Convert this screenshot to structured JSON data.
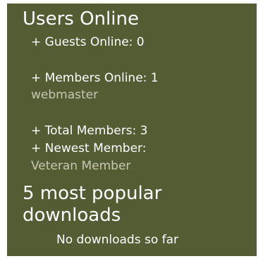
{
  "users_online": {
    "title": "Users Online",
    "guests": "+ Guests Online: 0",
    "members": "+ Members Online: 1",
    "member_list": [
      "webmaster"
    ],
    "total": "+ Total Members: 3",
    "newest_label": "+ Newest Member:",
    "newest_user": "Veteran Member"
  },
  "downloads": {
    "title_line1": "5 most popular",
    "title_line2": "downloads",
    "empty_text": "No downloads so far"
  },
  "colors": {
    "panel_bg": "#545c34",
    "text": "#ffffff",
    "link": "#c8c8b0",
    "page_bg": "#ffffff"
  }
}
